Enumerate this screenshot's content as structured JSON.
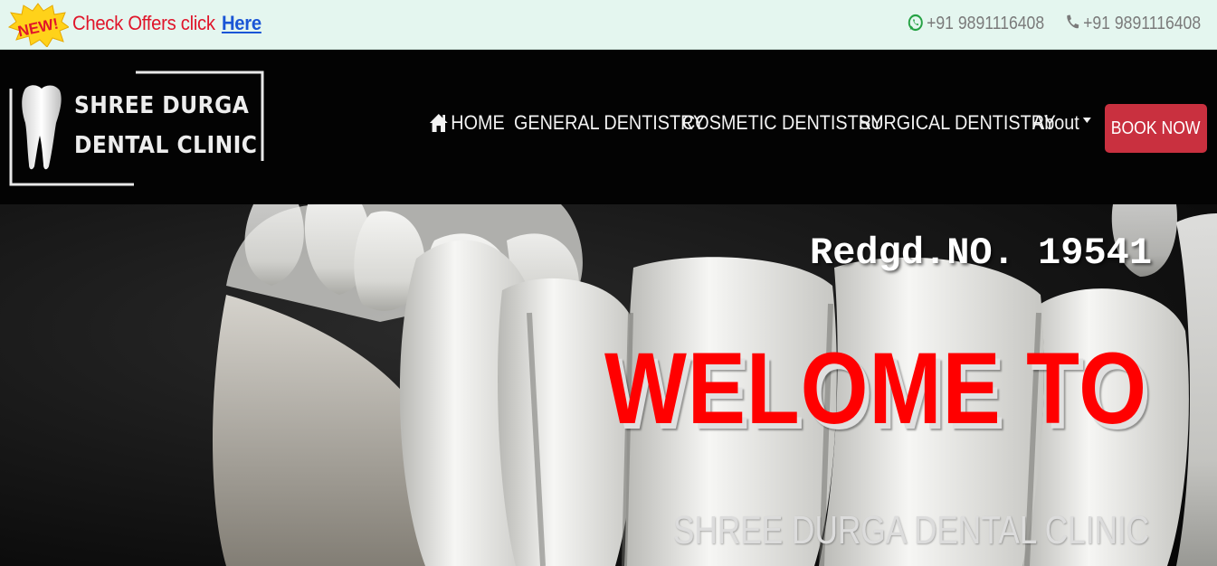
{
  "topbar": {
    "new_badge": "NEW!",
    "offer_text": "Check Offers click",
    "offer_link": "Here",
    "whatsapp": "+91 9891116408",
    "phone": "+91 9891116408"
  },
  "logo": {
    "line1": "SHREE DURGA",
    "line2": "DENTAL CLINIC"
  },
  "nav": {
    "home": "HOME",
    "general": "GENERAL DENTISTRY",
    "cosmetic": "COSMETIC DENTISTRY",
    "surgical": "SURGICAL DENTISTRY",
    "about": "About",
    "book": "BOOK NOW"
  },
  "hero": {
    "reg": "Redgd.NO. 19541",
    "welcome": "WELOME TO",
    "clinic": "SHREE DURGA DENTAL CLINIC"
  },
  "colors": {
    "topbar_bg": "#e4f6ef",
    "offer_red": "#e0152a",
    "link_blue": "#1a55d6",
    "navbar_bg": "#030303",
    "book_button": "#c9303f",
    "welcome_red": "#ff0000",
    "whatsapp_green": "#25a244"
  },
  "icons": {
    "new_badge": "new-starburst-icon",
    "whatsapp": "whatsapp-icon",
    "phone": "phone-icon",
    "home": "home-icon",
    "about_caret": "caret-down-icon",
    "tooth": "tooth-icon"
  }
}
